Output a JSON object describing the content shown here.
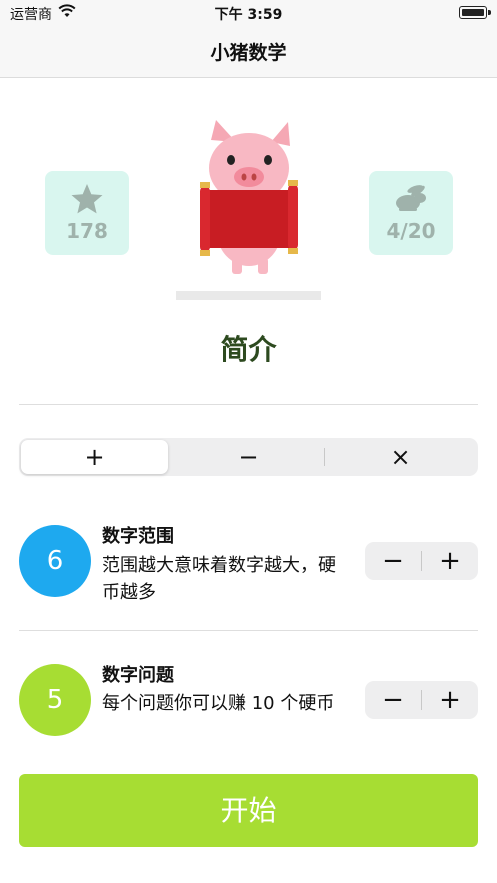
{
  "status_bar": {
    "carrier": "运营商",
    "time": "下午 3:59"
  },
  "nav": {
    "title": "小猪数学"
  },
  "stats": {
    "coins": {
      "icon": "star-icon",
      "value": "178"
    },
    "progress": {
      "icon": "rabbit-icon",
      "value": "4/20"
    }
  },
  "intro_label": "简介",
  "operations": {
    "items": [
      {
        "label": "+"
      },
      {
        "label": "−"
      },
      {
        "label": "×"
      }
    ],
    "selected": "+"
  },
  "settings": {
    "range": {
      "value": "6",
      "title": "数字范围",
      "desc": "范围越大意味着数字越大，硬币越多",
      "color": "#1ea9ef"
    },
    "questions": {
      "value": "5",
      "title": "数字问题",
      "desc": "每个问题你可以赚 10 个硬币",
      "color": "#a7dd33"
    }
  },
  "stepper": {
    "minus": "−",
    "plus": "+"
  },
  "start_label": "开始"
}
